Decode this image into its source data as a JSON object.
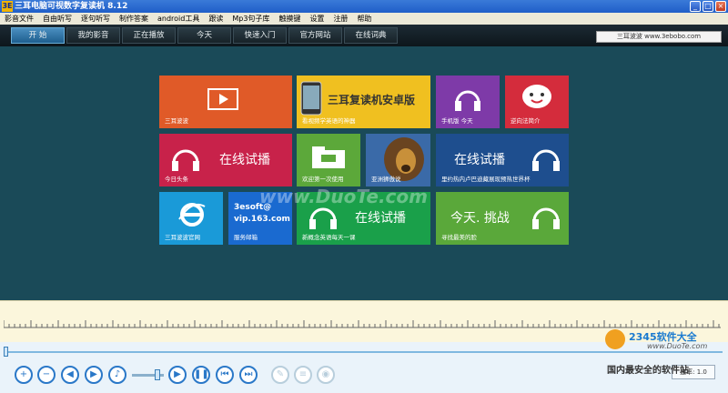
{
  "window": {
    "logo": "3E",
    "title": "三耳电脑可视数字复读机 8.12",
    "min": "_",
    "max": "□",
    "close": "×"
  },
  "menu": [
    "影音文件",
    "自由听写",
    "逐句听写",
    "制作答案",
    "android工具",
    "跟读",
    "Mp3句子库",
    "触摸键",
    "设置",
    "注册",
    "帮助"
  ],
  "nav": {
    "tabs": [
      "开  始",
      "我的影音",
      "正在播放",
      "今天",
      "快速入门",
      "官方网站",
      "在线词典"
    ],
    "active_index": 0,
    "site_label": "三耳波波 www.3ebobo.com"
  },
  "tiles": {
    "t1": {
      "caption": "三耳波波"
    },
    "t2": {
      "banner": "三耳复读机安卓版",
      "caption": "看视频学英语的神器"
    },
    "t3": {
      "caption": "手机版 今天"
    },
    "t4": {
      "caption": "逆向法简介"
    },
    "t5": {
      "title": "在线试播",
      "caption": "今日头条"
    },
    "t6": {
      "caption": "欢迎第一次使用"
    },
    "t7": {
      "caption": "亚洲狮傲说"
    },
    "t8": {
      "title": "在线试播",
      "caption": "里约热内卢巴迪藏展现预热世界杯"
    },
    "t9": {
      "caption": "三耳波波官网"
    },
    "t10": {
      "title_line1": "3esoft@",
      "title_line2": "vip.163.com",
      "caption": "服务邮箱"
    },
    "t11": {
      "title": "在线试播",
      "caption": "新概念英语每天一课"
    },
    "t12": {
      "title": "今天. 挑战",
      "caption": "寻找最美的脸"
    }
  },
  "player": {
    "seek_position": 0,
    "volume_level": 0.7,
    "speed_label": "速率: 1.0"
  },
  "watermarks": {
    "center": "www.DuoTe.com",
    "corner_brand": "2345软件大全",
    "corner_url": "www.DuoTe.com",
    "corner_slogan": "国内最安全的软件站"
  },
  "icons": [
    "zoom-in-icon",
    "zoom-out-icon",
    "prev-icon",
    "next-icon",
    "speaker-icon",
    "play-icon",
    "pause-icon",
    "skip-back-icon",
    "skip-forward-icon",
    "edit-icon",
    "list-icon",
    "eye-icon"
  ]
}
